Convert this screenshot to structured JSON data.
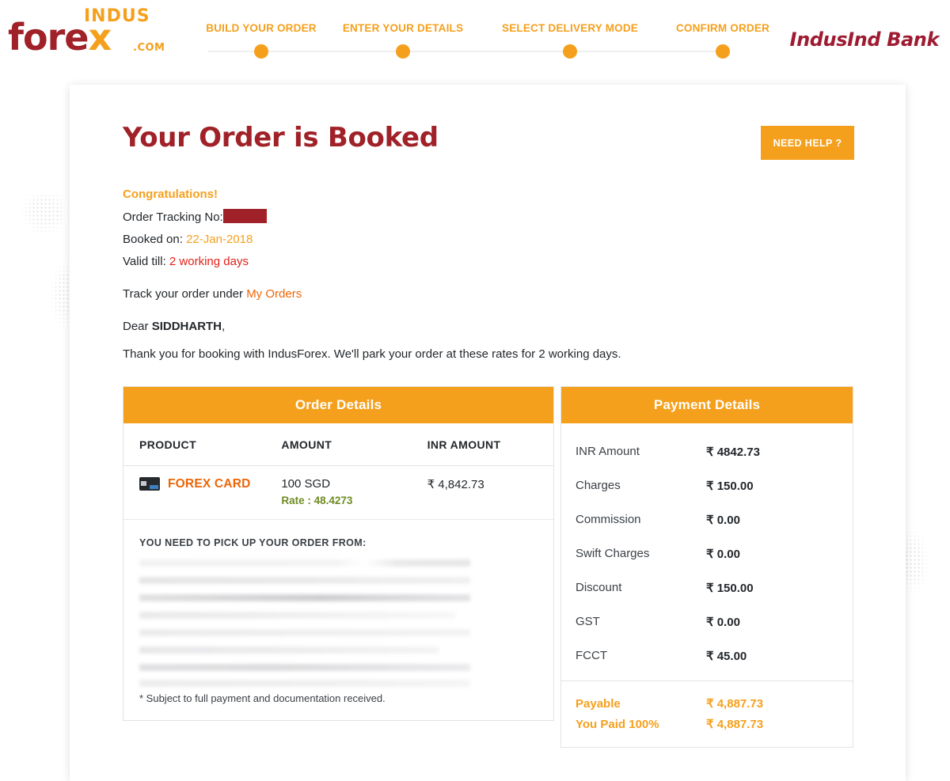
{
  "brand": {
    "logo_top": "INDUS",
    "logo_main_a": "fore",
    "logo_main_x": "x",
    "logo_dotcom": ".COM",
    "bank_name": "IndusInd Bank",
    "accent_orange": "#f5a01c",
    "brand_red": "#a02128",
    "link_orange": "#ec6608",
    "rate_green": "#6f8b23",
    "alert_red": "#e32119"
  },
  "stepper": {
    "steps": [
      {
        "label": "BUILD YOUR ORDER",
        "state": "done"
      },
      {
        "label": "ENTER YOUR DETAILS",
        "state": "done"
      },
      {
        "label": "SELECT DELIVERY MODE",
        "state": "done"
      },
      {
        "label": "CONFIRM ORDER",
        "state": "current"
      }
    ]
  },
  "page": {
    "title": "Your Order is Booked",
    "need_help_label": "NEED HELP ?"
  },
  "info": {
    "congratulations": "Congratulations!",
    "tracking_label": "Order Tracking No:",
    "tracking_value": "",
    "booked_label": "Booked on:",
    "booked_value": "22-Jan-2018",
    "valid_label": "Valid till:",
    "valid_value": "2 working days",
    "track_prefix": "Track your order under",
    "track_link": "My Orders",
    "dear_prefix": "Dear",
    "customer_name": "SIDDHARTH",
    "dear_suffix": ",",
    "thanks": "Thank you for booking with IndusForex. We'll park your order at these rates for 2 working days."
  },
  "order_details": {
    "heading": "Order Details",
    "columns": [
      "PRODUCT",
      "AMOUNT",
      "INR AMOUNT"
    ],
    "rows": [
      {
        "icon": "forex-card-icon",
        "product": "FOREX CARD",
        "amount": "100 SGD",
        "rate": "Rate : 48.4273",
        "inr_amount": "₹ 4,842.73"
      }
    ],
    "pickup_title": "YOU NEED TO PICK UP YOUR ORDER FROM:",
    "pickup_address_redacted": true,
    "footnote": "* Subject to full payment and documentation received."
  },
  "payment_details": {
    "heading": "Payment Details",
    "rows": [
      {
        "label": "INR Amount",
        "value": "₹ 4842.73"
      },
      {
        "label": "Charges",
        "value": "₹ 150.00"
      },
      {
        "label": "Commission",
        "value": "₹ 0.00"
      },
      {
        "label": "Swift Charges",
        "value": "₹ 0.00"
      },
      {
        "label": "Discount",
        "value": "₹ 150.00"
      },
      {
        "label": "GST",
        "value": "₹ 0.00"
      },
      {
        "label": "FCCT",
        "value": "₹ 45.00"
      }
    ],
    "totals": [
      {
        "label": "Payable",
        "value": "₹ 4,887.73"
      },
      {
        "label": "You Paid 100%",
        "value": "₹ 4,887.73"
      }
    ]
  }
}
